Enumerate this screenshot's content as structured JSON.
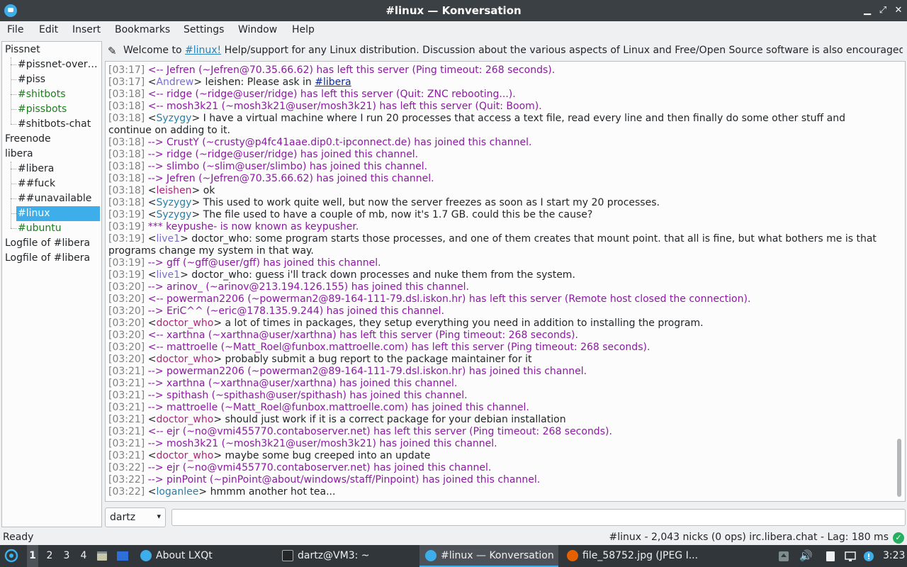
{
  "window": {
    "title": "#linux — Konversation"
  },
  "menu": [
    "File",
    "Edit",
    "Insert",
    "Bookmarks",
    "Settings",
    "Window",
    "Help"
  ],
  "sidebar": {
    "items": [
      {
        "label": "Pissnet",
        "level": 0,
        "color": "#232629"
      },
      {
        "label": "#pissnet-over…",
        "level": 1,
        "color": "#232629"
      },
      {
        "label": "#piss",
        "level": 1,
        "color": "#232629"
      },
      {
        "label": "#shitbots",
        "level": 1,
        "color": "#1e7d1e"
      },
      {
        "label": "#pissbots",
        "level": 1,
        "color": "#1e7d1e"
      },
      {
        "label": "#shitbots-chat",
        "level": 1,
        "color": "#232629"
      },
      {
        "label": "Freenode",
        "level": 0,
        "color": "#232629"
      },
      {
        "label": "libera",
        "level": 0,
        "color": "#232629"
      },
      {
        "label": "#libera",
        "level": 1,
        "color": "#232629"
      },
      {
        "label": "##fuck",
        "level": 1,
        "color": "#232629"
      },
      {
        "label": "##unavailable",
        "level": 1,
        "color": "#232629"
      },
      {
        "label": "#linux",
        "level": 1,
        "color": "#ffffff",
        "selected": true
      },
      {
        "label": "#ubuntu",
        "level": 1,
        "color": "#1e7d1e"
      },
      {
        "label": "Logfile of #libera",
        "level": 0,
        "color": "#232629"
      },
      {
        "label": "Logfile of #libera",
        "level": 0,
        "color": "#232629"
      }
    ]
  },
  "topic": {
    "prefix": "Welcome to ",
    "link": "#linux!",
    "rest": " Help/support for any Linux distribution. Discussion about the various aspects of Linux and Free/Open Source software is also encouraged. ..."
  },
  "chat": [
    {
      "ts": "[03:17]",
      "kind": "sys",
      "text": "<-- Jefren (~Jefren@70.35.66.62) has left this server (Ping timeout: 268 seconds)."
    },
    {
      "ts": "[03:17]",
      "kind": "msg",
      "nick": "Andrew",
      "nick_color": "#7a6fd0",
      "text": "leishen: Please ask in ",
      "link": "#libera"
    },
    {
      "ts": "[03:18]",
      "kind": "sys",
      "text": "<-- ridge (~ridge@user/ridge) has left this server (Quit: ZNC rebooting...)."
    },
    {
      "ts": "[03:18]",
      "kind": "sys",
      "text": "<-- mosh3k21 (~mosh3k21@user/mosh3k21) has left this server (Quit: Boom)."
    },
    {
      "ts": "[03:18]",
      "kind": "msg",
      "nick": "Syzygy",
      "nick_color": "#2e7fa6",
      "text": "I have a virtual machine where I run 20 processes that access a text file, read every line and then finally do some other stuff and continue on adding to it."
    },
    {
      "ts": "[03:18]",
      "kind": "sys",
      "text": "--> CrustY (~crusty@p4fc41aae.dip0.t-ipconnect.de) has joined this channel."
    },
    {
      "ts": "[03:18]",
      "kind": "sys",
      "text": "--> ridge (~ridge@user/ridge) has joined this channel."
    },
    {
      "ts": "[03:18]",
      "kind": "sys",
      "text": "--> slimbo (~slim@user/slimbo) has joined this channel."
    },
    {
      "ts": "[03:18]",
      "kind": "sys",
      "text": "--> Jefren (~Jefren@70.35.66.62) has joined this channel."
    },
    {
      "ts": "[03:18]",
      "kind": "msg",
      "nick": "leishen",
      "nick_color": "#b0257a",
      "text": "ok"
    },
    {
      "ts": "[03:18]",
      "kind": "msg",
      "nick": "Syzygy",
      "nick_color": "#2e7fa6",
      "text": "This used to work quite well, but now the server freezes as soon as I start my 20 processes."
    },
    {
      "ts": "[03:19]",
      "kind": "msg",
      "nick": "Syzygy",
      "nick_color": "#2e7fa6",
      "text": "The file used to  have a couple of mb, now it's 1.7 GB. could this be the cause?"
    },
    {
      "ts": "[03:19]",
      "kind": "sys",
      "text": "*** keypushe- is now known as keypusher."
    },
    {
      "ts": "[03:19]",
      "kind": "msg",
      "nick": "live1",
      "nick_color": "#7a6fd0",
      "text": "doctor_who: some program starts those processes, and one of them creates that mount point. that all is fine, but what bothers me is that programs change my system in that way."
    },
    {
      "ts": "[03:19]",
      "kind": "sys",
      "text": "--> gff (~gff@user/gff) has joined this channel."
    },
    {
      "ts": "[03:19]",
      "kind": "msg",
      "nick": "live1",
      "nick_color": "#7a6fd0",
      "text": "doctor_who: guess i'll track down processes and nuke them from the system."
    },
    {
      "ts": "[03:20]",
      "kind": "sys",
      "text": "--> arinov_ (~arinov@213.194.126.155) has joined this channel."
    },
    {
      "ts": "[03:20]",
      "kind": "sys",
      "text": "<-- powerman2206 (~powerman2@89-164-111-79.dsl.iskon.hr) has left this server (Remote host closed the connection)."
    },
    {
      "ts": "[03:20]",
      "kind": "sys",
      "text": "--> EriC^^ (~eric@178.135.9.244) has joined this channel."
    },
    {
      "ts": "[03:20]",
      "kind": "msg",
      "nick": "doctor_who",
      "nick_color": "#b0257a",
      "text": "a lot of times in packages, they setup everything you need in addition to installing the program."
    },
    {
      "ts": "[03:20]",
      "kind": "sys",
      "text": "<-- xarthna (~xarthna@user/xarthna) has left this server (Ping timeout: 268 seconds)."
    },
    {
      "ts": "[03:20]",
      "kind": "sys",
      "text": "<-- mattroelle (~Matt_Roel@funbox.mattroelle.com) has left this server (Ping timeout: 268 seconds)."
    },
    {
      "ts": "[03:20]",
      "kind": "msg",
      "nick": "doctor_who",
      "nick_color": "#b0257a",
      "text": "probably submit a bug report to the package maintainer for it"
    },
    {
      "ts": "[03:21]",
      "kind": "sys",
      "text": "--> powerman2206 (~powerman2@89-164-111-79.dsl.iskon.hr) has joined this channel."
    },
    {
      "ts": "[03:21]",
      "kind": "sys",
      "text": "--> xarthna (~xarthna@user/xarthna) has joined this channel."
    },
    {
      "ts": "[03:21]",
      "kind": "sys",
      "text": "--> spithash (~spithash@user/spithash) has joined this channel."
    },
    {
      "ts": "[03:21]",
      "kind": "sys",
      "text": "--> mattroelle (~Matt_Roel@funbox.mattroelle.com) has joined this channel."
    },
    {
      "ts": "[03:21]",
      "kind": "msg",
      "nick": "doctor_who",
      "nick_color": "#b0257a",
      "text": "should just work if it is a correct package for your debian installation"
    },
    {
      "ts": "[03:21]",
      "kind": "sys",
      "text": "<-- ejr (~no@vmi455770.contaboserver.net) has left this server (Ping timeout: 268 seconds)."
    },
    {
      "ts": "[03:21]",
      "kind": "sys",
      "text": "--> mosh3k21 (~mosh3k21@user/mosh3k21) has joined this channel."
    },
    {
      "ts": "[03:21]",
      "kind": "msg",
      "nick": "doctor_who",
      "nick_color": "#b0257a",
      "text": "maybe some bug creeped into an update"
    },
    {
      "ts": "[03:22]",
      "kind": "sys",
      "text": "--> ejr (~no@vmi455770.contaboserver.net) has joined this channel."
    },
    {
      "ts": "[03:22]",
      "kind": "sys",
      "text": "--> pinPoint (~pinPoint@about/windows/staff/Pinpoint) has joined this channel."
    },
    {
      "ts": "[03:22]",
      "kind": "msg",
      "nick": "loganlee",
      "nick_color": "#2e7fa6",
      "text": "hmmm another hot tea..."
    }
  ],
  "input": {
    "nick": "dartz",
    "value": ""
  },
  "status": {
    "left": "Ready",
    "right": "#linux - 2,043 nicks (0 ops)  irc.libera.chat - Lag: 180 ms"
  },
  "taskbar": {
    "desktops": [
      "1",
      "2",
      "3",
      "4"
    ],
    "active_desktop": "1",
    "tasks": [
      {
        "label": "About LXQt",
        "icon": "lxqt-icon"
      },
      {
        "label": "dartz@VM3: ~",
        "icon": "terminal-icon"
      },
      {
        "label": "#linux — Konversation",
        "icon": "konversation-icon",
        "active": true
      },
      {
        "label": "file_58752.jpg (JPEG I...",
        "icon": "firefox-icon"
      }
    ],
    "clock": "3:23"
  }
}
